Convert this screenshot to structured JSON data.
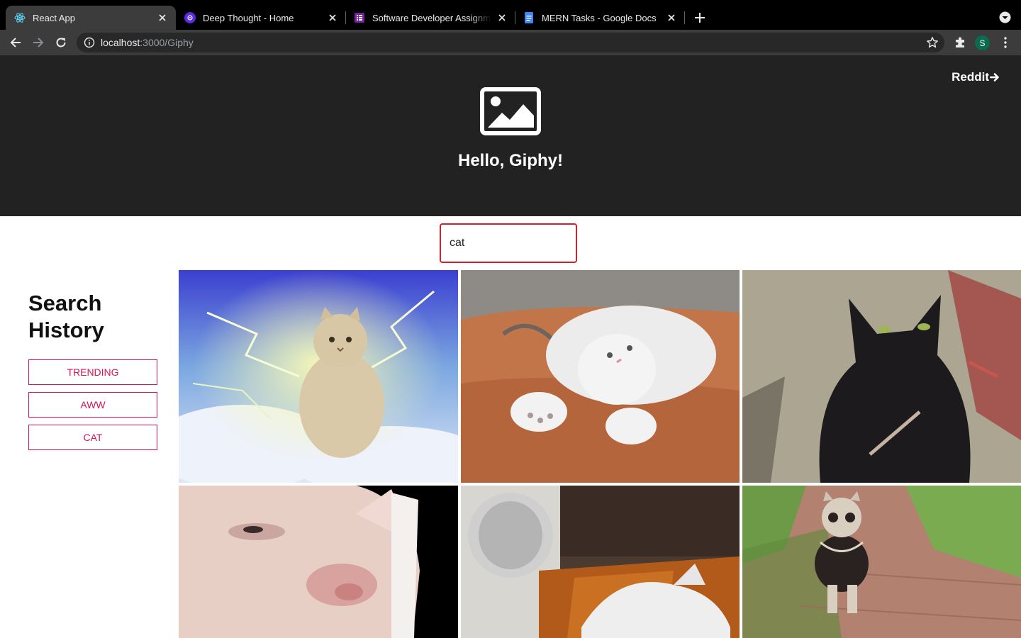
{
  "browser": {
    "tabs": [
      {
        "title": "React App",
        "active": true
      },
      {
        "title": "Deep Thought - Home",
        "active": false
      },
      {
        "title": "Software Developer Assignment",
        "active": false
      },
      {
        "title": "MERN Tasks - Google Docs",
        "active": false
      }
    ],
    "url_host": "localhost",
    "url_path": ":3000/Giphy",
    "profile_initial": "S"
  },
  "header": {
    "nav_link": "Reddit",
    "title": "Hello, Giphy!"
  },
  "search": {
    "value": "cat"
  },
  "history": {
    "title": "Search History",
    "items": [
      "TRENDING",
      "AWW",
      "CAT"
    ]
  },
  "gifs": [
    {
      "subject": "fluffy cat with lightning"
    },
    {
      "subject": "white cat rolling on floor"
    },
    {
      "subject": "black cat"
    },
    {
      "subject": "cat face close-up"
    },
    {
      "subject": "cat knocking glass"
    },
    {
      "subject": "kitten running"
    }
  ],
  "colors": {
    "hero_bg": "#222222",
    "accent": "#d4145a",
    "input_border": "#d41f2f"
  }
}
